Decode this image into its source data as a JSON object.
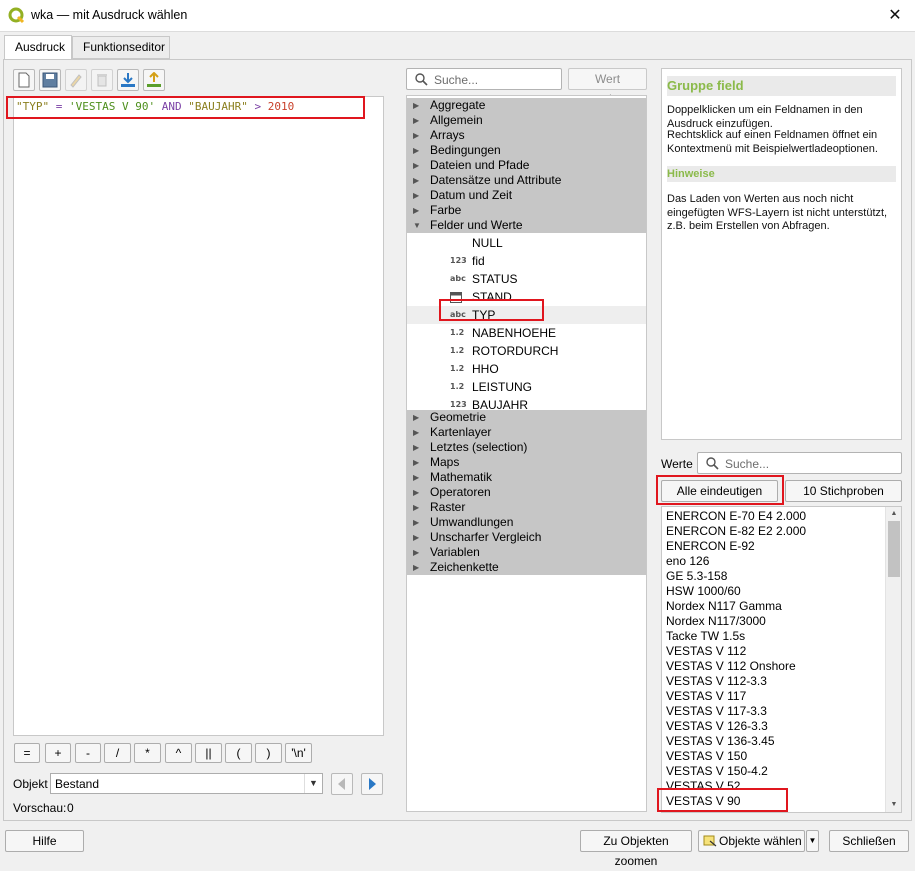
{
  "window": {
    "title": "wka — mit Ausdruck wählen",
    "close_label": "✕"
  },
  "tabs": [
    {
      "label": "Ausdruck"
    },
    {
      "label": "Funktionseditor"
    }
  ],
  "expression": {
    "field1": "\"TYP\"",
    "eq": " = ",
    "value": "'VESTAS V 90'",
    "and": " AND ",
    "field2": "\"BAUJAHR\"",
    "gt": " > ",
    "number": "2010"
  },
  "operators": [
    "=",
    "+",
    "-",
    "/",
    "*",
    "^",
    "||",
    "(",
    ")",
    "'\\n'"
  ],
  "objekt": {
    "label": "Objekt",
    "value": "Bestand"
  },
  "preview": {
    "label": "Vorschau:",
    "value": "0"
  },
  "function_search": {
    "placeholder": "Suche..."
  },
  "show_value_button": "Wert anzeigen",
  "groups_top": [
    "Aggregate",
    "Allgemein",
    "Arrays",
    "Bedingungen",
    "Dateien und Pfade",
    "Datensätze und Attribute",
    "Datum und Zeit",
    "Farbe",
    "Felder und Werte"
  ],
  "fields": [
    {
      "icon": "",
      "name": "NULL"
    },
    {
      "icon": "123",
      "name": "fid"
    },
    {
      "icon": "abc",
      "name": "STATUS"
    },
    {
      "icon": "cal",
      "name": "STAND"
    },
    {
      "icon": "abc",
      "name": "TYP"
    },
    {
      "icon": "1.2",
      "name": "NABENHOEHE"
    },
    {
      "icon": "1.2",
      "name": "ROTORDURCH"
    },
    {
      "icon": "1.2",
      "name": "HHO"
    },
    {
      "icon": "1.2",
      "name": "LEISTUNG"
    },
    {
      "icon": "123",
      "name": "BAUJAHR"
    }
  ],
  "groups_bottom": [
    "Geometrie",
    "Kartenlayer",
    "Letztes (selection)",
    "Maps",
    "Mathematik",
    "Operatoren",
    "Raster",
    "Umwandlungen",
    "Unscharfer Vergleich",
    "Variablen",
    "Zeichenkette"
  ],
  "help": {
    "title": "Gruppe field",
    "para1": "Doppelklicken um ein Feldnamen in den Ausdruck einzufügen.",
    "para2": "Rechtsklick auf einen Feldnamen öffnet ein Kontextmenü mit Beispielwertladeoptionen.",
    "hint_title": "Hinweise",
    "hint": "Das Laden von Werten aus noch nicht eingefügten WFS-Layern ist nicht unterstützt, z.B. beim Erstellen von Abfragen."
  },
  "values": {
    "label": "Werte",
    "search_placeholder": "Suche...",
    "all_unique_button": "Alle eindeutigen",
    "samples_button": "10 Stichproben",
    "items": [
      "ENERCON E-70 E4 2.000",
      "ENERCON E-82 E2 2.000",
      "ENERCON E-92",
      "eno 126",
      "GE 5.3-158",
      "HSW 1000/60",
      "Nordex N117 Gamma",
      "Nordex N117/3000",
      "Tacke TW 1.5s",
      "VESTAS V 112",
      "VESTAS V 112 Onshore",
      "VESTAS V 112-3.3",
      "VESTAS V 117",
      "VESTAS V 117-3.3",
      "VESTAS V 126-3.3",
      "VESTAS V 136-3.45",
      "VESTAS V 150",
      "VESTAS V 150-4.2",
      "VESTAS V 52",
      "VESTAS V 90"
    ]
  },
  "footer": {
    "help_button": "Hilfe",
    "zoom_button": "Zu Objekten zoomen",
    "select_button": "Objekte wählen",
    "close_button": "Schließen"
  },
  "colors": {
    "accent_red": "#e0161e",
    "help_green": "#8bba4a",
    "group_bg": "#c6c6c6"
  }
}
